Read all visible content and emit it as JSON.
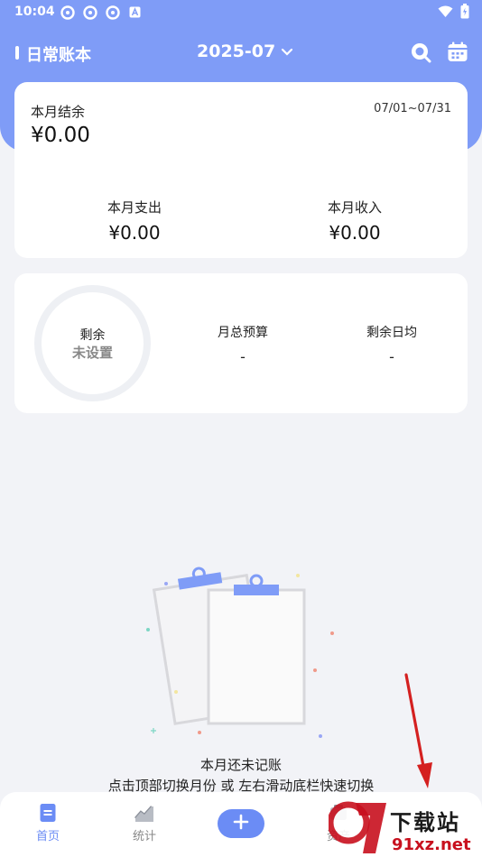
{
  "status_bar": {
    "time": "10:04"
  },
  "top_bar": {
    "book_title": "日常账本",
    "month": "2025-07"
  },
  "summary": {
    "balance_label": "本月结余",
    "balance_value": "¥0.00",
    "date_range": "07/01~07/31",
    "expense_label": "本月支出",
    "expense_value": "¥0.00",
    "income_label": "本月收入",
    "income_value": "¥0.00"
  },
  "budget": {
    "remaining_label": "剩余",
    "remaining_status": "未设置",
    "monthly_budget_label": "月总预算",
    "monthly_budget_value": "-",
    "daily_avg_label": "剩余日均",
    "daily_avg_value": "-"
  },
  "empty_state": {
    "title": "本月还未记账",
    "hint": "点击顶部切换月份 或 左右滑动底栏快速切换"
  },
  "bottom_nav": {
    "items": [
      {
        "label": "首页",
        "icon": "home-doc-icon",
        "active": true
      },
      {
        "label": "统计",
        "icon": "chart-icon",
        "active": false
      },
      {
        "label": "资产",
        "icon": "assets-icon",
        "active": false
      }
    ],
    "add_icon": "plus-icon"
  },
  "watermark": {
    "brand": "下载站",
    "url": "91xz.net"
  },
  "colors": {
    "primary": "#7f9cf7",
    "accent": "#6b8cf5",
    "background": "#f2f3f7",
    "arrow": "#d42020"
  }
}
